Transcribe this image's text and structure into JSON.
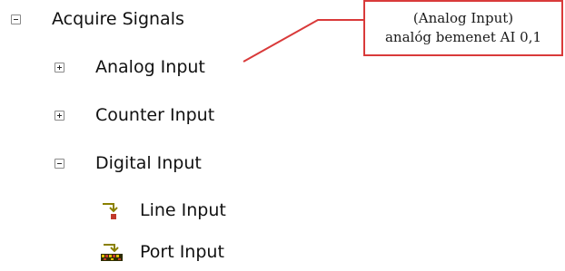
{
  "tree": {
    "acquire": {
      "label": "Acquire Signals",
      "expanded": true
    },
    "analog": {
      "label": "Analog Input",
      "expanded": false
    },
    "counter": {
      "label": "Counter Input",
      "expanded": false
    },
    "digital": {
      "label": "Digital Input",
      "expanded": true
    },
    "line": {
      "label": "Line Input",
      "icon": "line-input-icon"
    },
    "port": {
      "label": "Port Input",
      "icon": "port-input-icon"
    }
  },
  "callout": {
    "line1": "(Analog Input)",
    "line2": "analóg bemenet AI 0,1",
    "color": "#d93a3a"
  }
}
